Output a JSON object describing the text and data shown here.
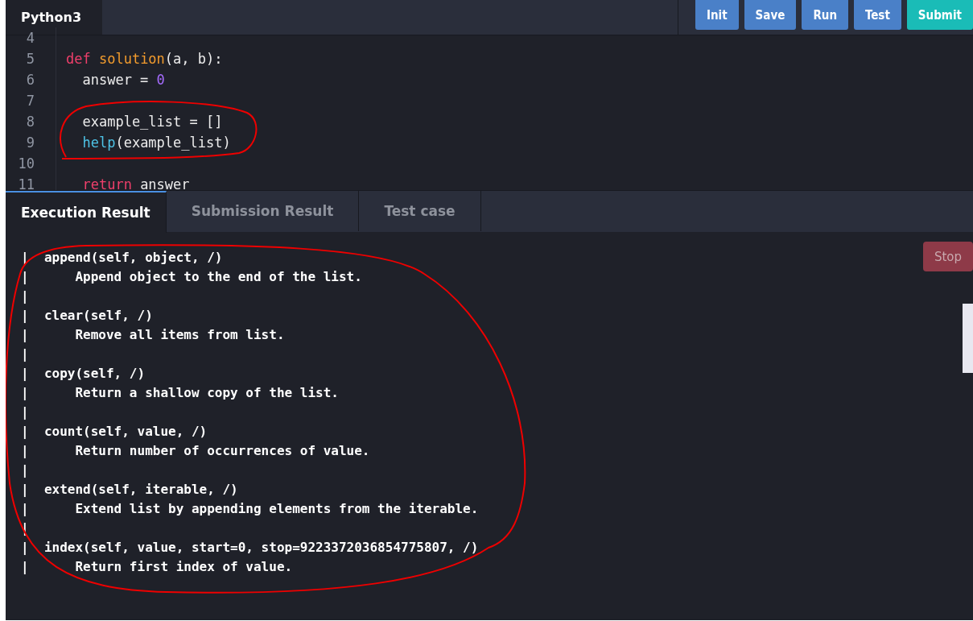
{
  "editor": {
    "language_tab": "Python3",
    "toolbar_buttons": [
      {
        "label": "Init",
        "kind": "primary"
      },
      {
        "label": "Save",
        "kind": "primary"
      },
      {
        "label": "Run",
        "kind": "primary"
      },
      {
        "label": "Test",
        "kind": "primary"
      },
      {
        "label": "Submit",
        "kind": "accent"
      }
    ],
    "lines": [
      {
        "number": "4"
      },
      {
        "number": "5",
        "tokens": [
          {
            "text": "def ",
            "kind": "keyword"
          },
          {
            "text": "solution",
            "kind": "function"
          },
          {
            "text": "(a, b):",
            "kind": "plain"
          }
        ]
      },
      {
        "number": "6",
        "tokens": [
          {
            "text": "  answer = ",
            "kind": "plain"
          },
          {
            "text": "0",
            "kind": "number"
          }
        ]
      },
      {
        "number": "7"
      },
      {
        "number": "8",
        "tokens": [
          {
            "text": "  example_list = []",
            "kind": "plain"
          }
        ]
      },
      {
        "number": "9",
        "tokens": [
          {
            "text": "  help",
            "kind": "builtin"
          },
          {
            "text": "(example_list)",
            "kind": "plain"
          }
        ]
      },
      {
        "number": "10"
      },
      {
        "number": "11",
        "tokens": [
          {
            "text": "  return",
            "kind": "keyword"
          },
          {
            "text": " answer",
            "kind": "plain"
          }
        ]
      }
    ]
  },
  "result_tabs": [
    {
      "label": "Execution Result",
      "selected": true
    },
    {
      "label": "Submission Result",
      "selected": false
    },
    {
      "label": "Test case",
      "selected": false
    }
  ],
  "stop_button": {
    "label": "Stop",
    "disabled": true
  },
  "output_lines": [
    "|  append(self, object, /)",
    "|      Append object to the end of the list.",
    "|",
    "|  clear(self, /)",
    "|      Remove all items from list.",
    "|",
    "|  copy(self, /)",
    "|      Return a shallow copy of the list.",
    "|",
    "|  count(self, value, /)",
    "|      Return number of occurrences of value.",
    "|",
    "|  extend(self, iterable, /)",
    "|      Extend list by appending elements from the iterable.",
    "|",
    "|  index(self, value, start=0, stop=9223372036854775807, /)",
    "|      Return first index of value."
  ]
}
